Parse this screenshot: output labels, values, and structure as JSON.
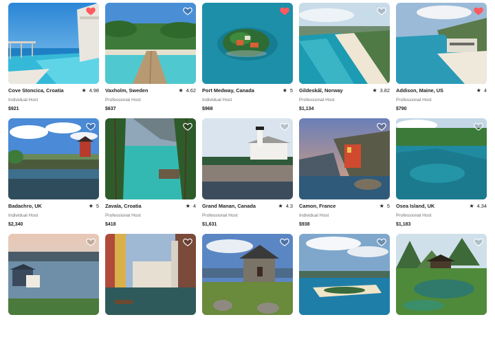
{
  "listings": [
    {
      "location": "Cove Stoncica, Croatia",
      "rating": "4.98",
      "host": "Individual Host",
      "price": "$921",
      "favorited": true,
      "scene": "infinity-pool"
    },
    {
      "location": "Vaxholm, Sweden",
      "rating": "4.62",
      "host": "Professional Host",
      "price": "$637",
      "favorited": false,
      "scene": "pier"
    },
    {
      "location": "Port Medway, Canada",
      "rating": "5",
      "host": "Individual Host",
      "price": "$968",
      "favorited": true,
      "scene": "island"
    },
    {
      "location": "Gildeskål, Norway",
      "rating": "3.82",
      "host": "Professional Host",
      "price": "$1,134",
      "favorited": false,
      "scene": "beach"
    },
    {
      "location": "Addison, Maine, US",
      "rating": "4",
      "host": "Professional Host",
      "price": "$790",
      "favorited": true,
      "scene": "coast-villa"
    },
    {
      "location": "Badachro, UK",
      "rating": "5",
      "host": "Individual Host",
      "price": "$2,340",
      "favorited": false,
      "scene": "lake-tower"
    },
    {
      "location": "Zavala, Croatia",
      "rating": "4",
      "host": "Professional Host",
      "price": "$418",
      "favorited": false,
      "scene": "turquoise-lake"
    },
    {
      "location": "Grand Manan, Canada",
      "rating": "4.3",
      "host": "Professional Host",
      "price": "$1,631",
      "favorited": false,
      "scene": "lighthouse"
    },
    {
      "location": "Camon, France",
      "rating": "5",
      "host": "Individual Host",
      "price": "$938",
      "favorited": false,
      "scene": "cliff-village"
    },
    {
      "location": "Osea Island, UK",
      "rating": "4.34",
      "host": "Professional Host",
      "price": "$1,183",
      "favorited": false,
      "scene": "bay"
    },
    {
      "favorited": false,
      "scene": "boathouse"
    },
    {
      "favorited": false,
      "scene": "canal"
    },
    {
      "favorited": false,
      "scene": "stone-house"
    },
    {
      "favorited": false,
      "scene": "aerial-coast"
    },
    {
      "favorited": false,
      "scene": "karst-pagoda"
    }
  ],
  "colors": {
    "heart_active": "#ff5a5f",
    "heart_outline": "#ffffff",
    "star": "#222222",
    "muted_text": "#717171"
  },
  "icons": {
    "star": "★",
    "heart": "heart-icon"
  }
}
